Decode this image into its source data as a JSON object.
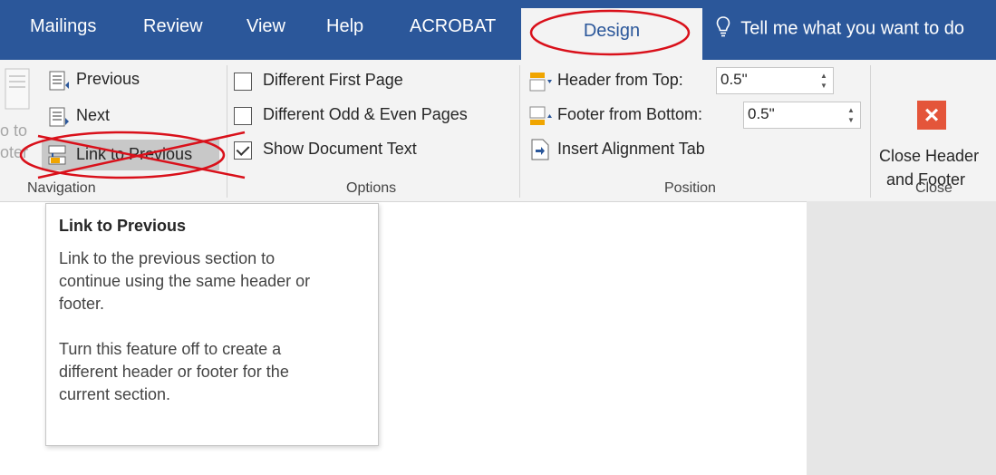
{
  "tabs": [
    "Mailings",
    "Review",
    "View",
    "Help",
    "ACROBAT"
  ],
  "active_tab": "Design",
  "tell_me": "Tell me what you want to do",
  "navigation": {
    "label": "Navigation",
    "previous": "Previous",
    "next": "Next",
    "link_to_previous": "Link to Previous",
    "goto_fragment_1": "o to",
    "goto_fragment_2": "oter"
  },
  "options": {
    "label": "Options",
    "different_first_page": "Different First Page",
    "different_first_page_checked": false,
    "different_odd_even": "Different Odd & Even Pages",
    "different_odd_even_checked": false,
    "show_document_text": "Show Document Text",
    "show_document_text_checked": true
  },
  "position": {
    "label": "Position",
    "header_from_top": "Header from Top:",
    "header_value": "0.5\"",
    "footer_from_bottom": "Footer from Bottom:",
    "footer_value": "0.5\"",
    "insert_alignment_tab": "Insert Alignment Tab"
  },
  "close": {
    "label": "Close",
    "button_line1": "Close Header",
    "button_line2": "and Footer"
  },
  "tooltip": {
    "title": "Link to Previous",
    "body": "Link to the previous section to\ncontinue using the same header or\nfooter.\n\nTurn this feature off to create a\ndifferent header or footer for the\ncurrent section."
  },
  "colors": {
    "tabbar": "#2b579a",
    "annotation": "#d9101a",
    "close_button": "#e4553a"
  }
}
